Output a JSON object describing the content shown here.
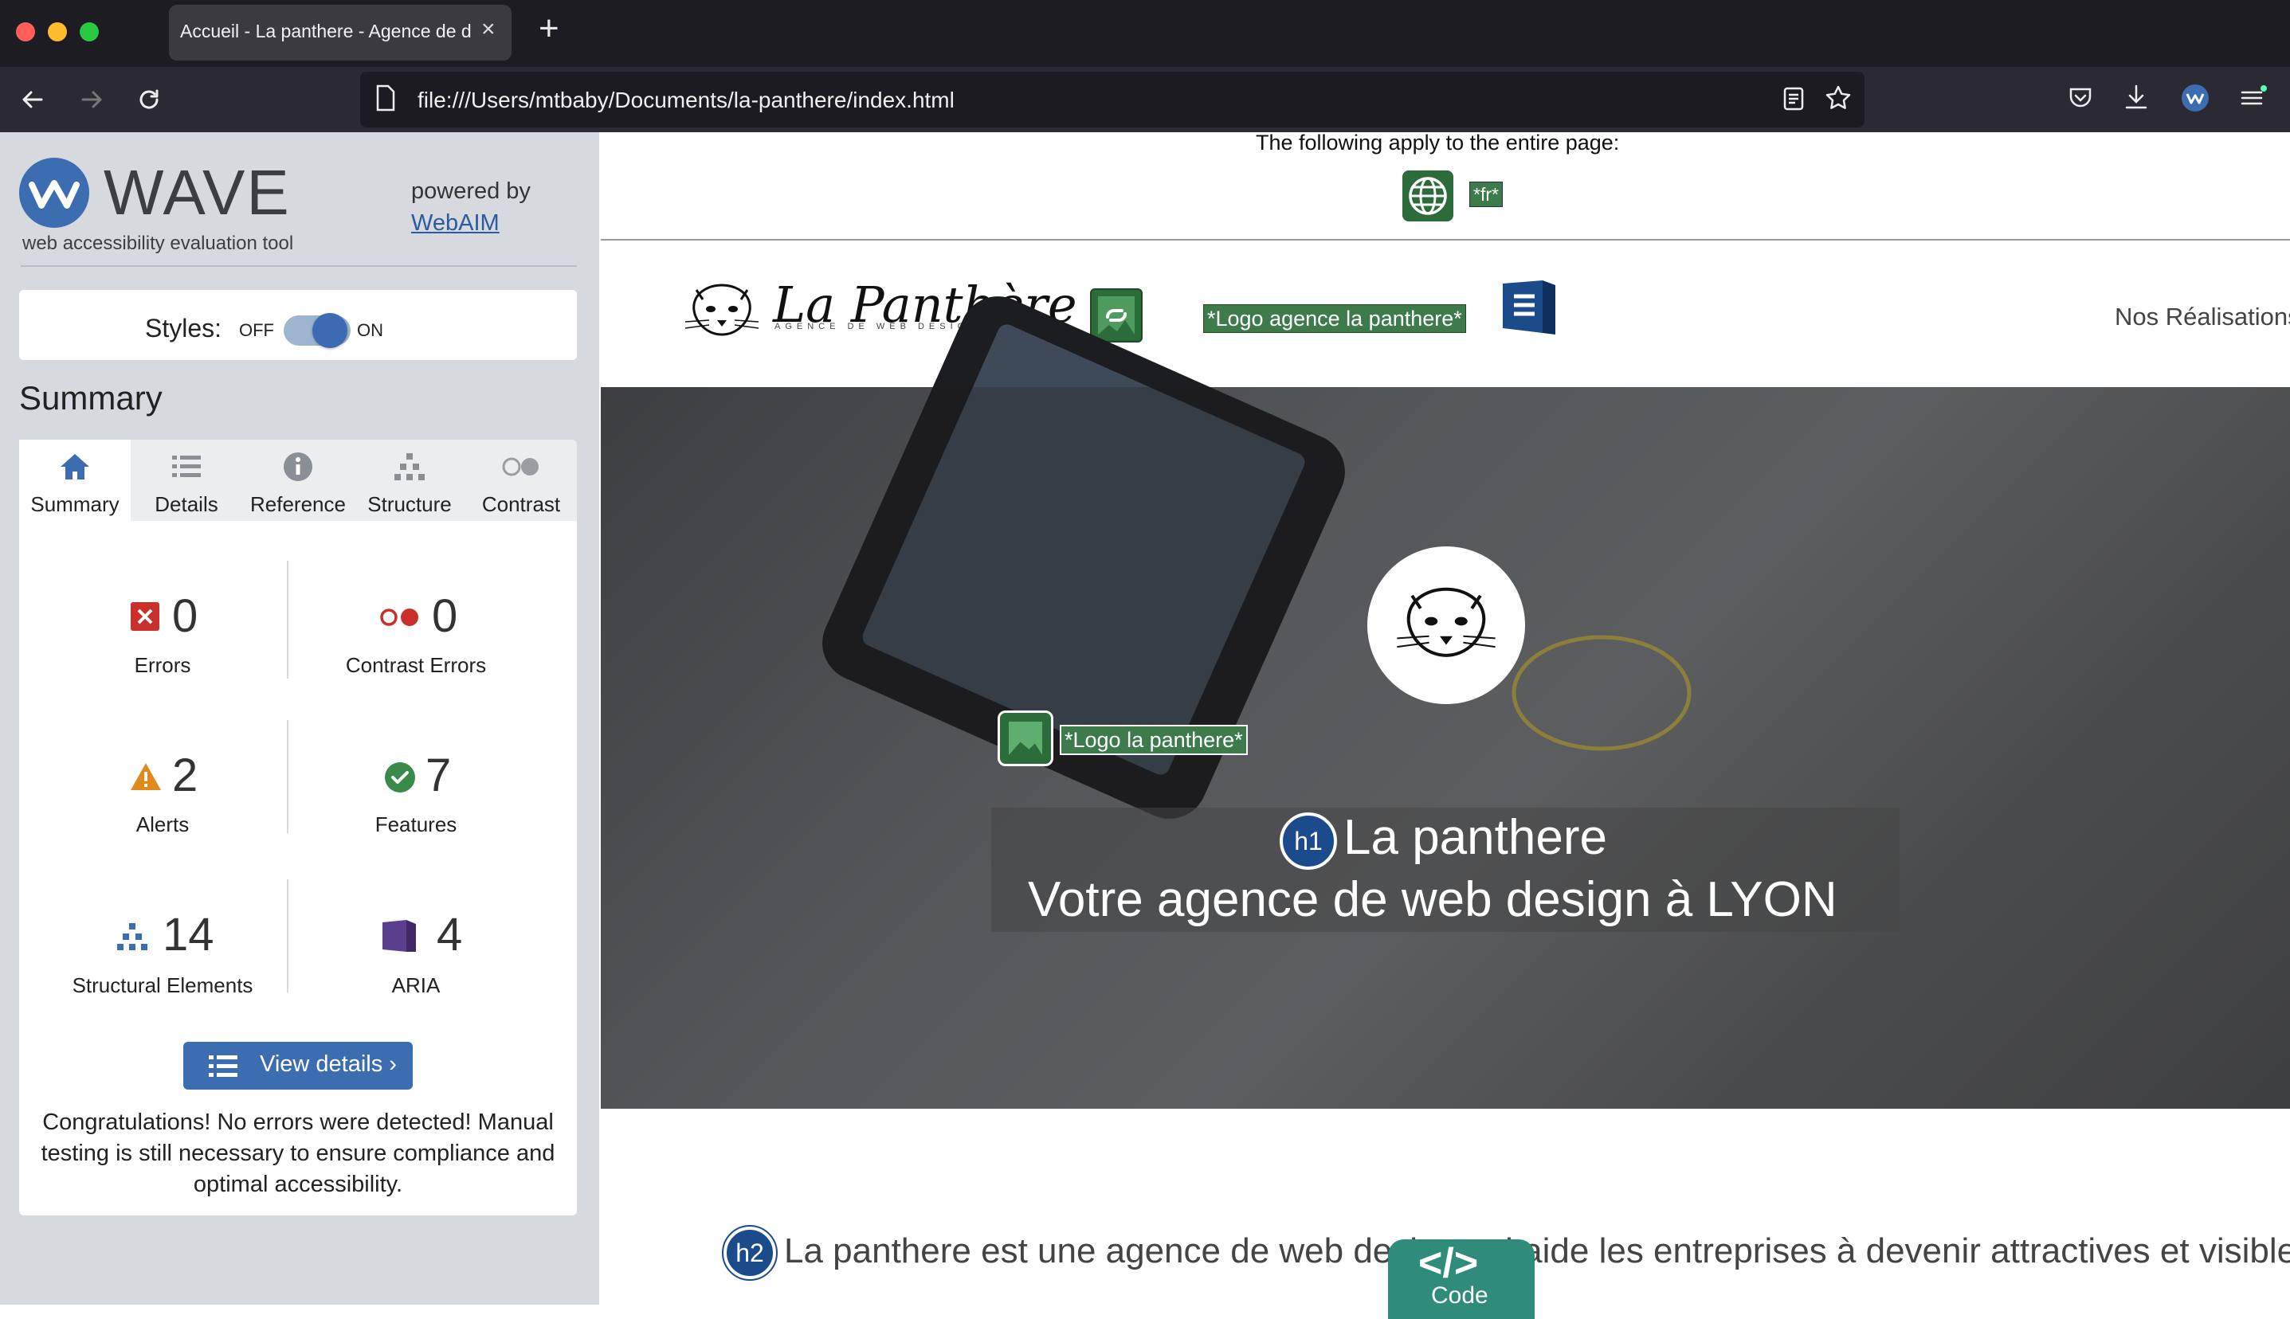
{
  "browser": {
    "tab_title": "Accueil - La panthere - Agence de d",
    "close_glyph": "×",
    "new_tab_glyph": "+",
    "url": "file:///Users/mtbaby/Documents/la-panthere/index.html"
  },
  "wave": {
    "title": "WAVE",
    "tagline": "web accessibility evaluation tool",
    "powered_by": "powered by",
    "webaim_link": "WebAIM",
    "styles_label": "Styles:",
    "styles_off": "OFF",
    "styles_on": "ON",
    "styles_enabled": true,
    "summary_heading": "Summary",
    "tabs": [
      {
        "label": "Summary",
        "icon": "home-icon",
        "active": true
      },
      {
        "label": "Details",
        "icon": "list-icon"
      },
      {
        "label": "Reference",
        "icon": "info-icon"
      },
      {
        "label": "Structure",
        "icon": "hierarchy-icon"
      },
      {
        "label": "Contrast",
        "icon": "contrast-icon"
      }
    ],
    "stats": {
      "errors": {
        "value": "0",
        "label": "Errors"
      },
      "contrast_errors": {
        "value": "0",
        "label": "Contrast Errors"
      },
      "alerts": {
        "value": "2",
        "label": "Alerts"
      },
      "features": {
        "value": "7",
        "label": "Features"
      },
      "structural": {
        "value": "14",
        "label": "Structural Elements"
      },
      "aria": {
        "value": "4",
        "label": "ARIA"
      }
    },
    "view_details": "View details ›",
    "congrats": "Congratulations! No errors were detected! Manual testing is still necessary to ensure compliance and optimal accessibility."
  },
  "page": {
    "apply_text": "The following apply to the entire page:",
    "lang_badge": "*fr*",
    "brand_name": "La Panthère",
    "brand_sub": "AGENCE DE WEB DESIGN",
    "logo_alt_1": "*Logo agence la panthere*",
    "nav_item": "Nos Réalisations",
    "logo_alt_2": "*Logo la panthere*",
    "h1_badge": "h1",
    "hero_title": "La panthere",
    "hero_subtitle": "Votre agence de web design à LYON",
    "h2_badge": "h2",
    "intro": "La panthere est une agence de web design qui aide les entreprises à devenir attractives et visibles",
    "code_glyph": "</>",
    "code_label": "Code"
  },
  "colors": {
    "wave_blue": "#3b6db0",
    "wave_green": "#2c6b3a",
    "error_red": "#c9302c",
    "alert_orange": "#e08a1e",
    "feature_green": "#3a8a4a",
    "aria_purple": "#5b3f8e",
    "code_teal": "#2f8c7a"
  }
}
